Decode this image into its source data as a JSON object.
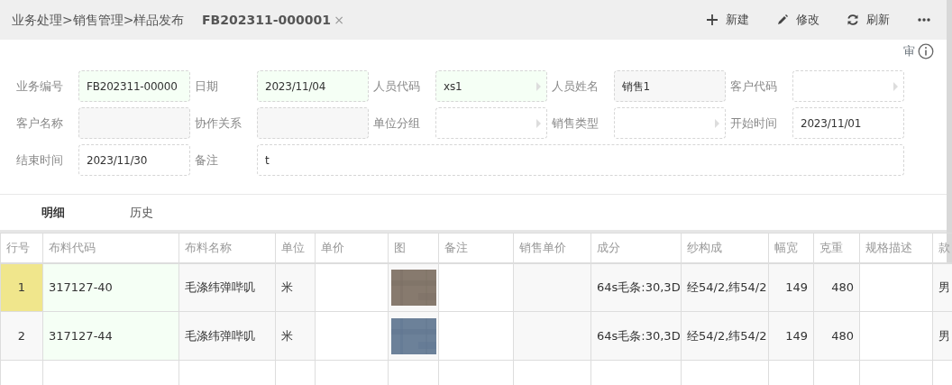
{
  "header": {
    "breadcrumb": "业务处理>销售管理>样品发布",
    "tab": {
      "label": "FB202311-000001",
      "close": "×"
    },
    "actions": [
      {
        "kind": "add",
        "label": "新建"
      },
      {
        "kind": "edit",
        "label": "修改"
      },
      {
        "kind": "refresh",
        "label": "刷新"
      },
      {
        "kind": "more"
      }
    ]
  },
  "audit": {
    "label": "审"
  },
  "form": [
    {
      "label": "业务编号",
      "value": "FB202311-00000",
      "kind": "required",
      "lookup": false
    },
    {
      "label": "日期",
      "value": "2023/11/04",
      "kind": "required",
      "lookup": false
    },
    {
      "label": "人员代码",
      "value": "xs1",
      "kind": "required",
      "lookup": true
    },
    {
      "label": "人员姓名",
      "value": "销售1",
      "kind": "readonly",
      "lookup": false
    },
    {
      "label": "客户代码",
      "kind": "normal",
      "lookup": true
    },
    {
      "label": "客户名称",
      "kind": "readonly",
      "lookup": false
    },
    {
      "label": "协作关系",
      "kind": "readonly",
      "lookup": false
    },
    {
      "label": "单位分组",
      "kind": "normal",
      "lookup": true
    },
    {
      "label": "销售类型",
      "kind": "normal",
      "lookup": true
    },
    {
      "label": "开始时间",
      "value": "2023/11/01",
      "kind": "normal",
      "lookup": false
    },
    {
      "label": "结束时间",
      "value": "2023/11/30",
      "kind": "normal",
      "lookup": false
    },
    {
      "label": "备注",
      "value": "t",
      "kind": "normal",
      "lookup": false,
      "wide": true
    }
  ],
  "tabs": [
    {
      "label": "明细",
      "selected": true
    },
    {
      "label": "历史",
      "selected": false
    }
  ],
  "table": {
    "columns": [
      {
        "label": "行号",
        "kind": "index"
      },
      {
        "label": "布料代码",
        "kind": "input"
      },
      {
        "label": "布料名称",
        "kind": "readonly"
      },
      {
        "label": "单位",
        "kind": "readonly"
      },
      {
        "label": "单价",
        "kind": "blank"
      },
      {
        "label": "图"
      },
      {
        "label": "备注",
        "kind": "blank"
      },
      {
        "label": "销售单价",
        "kind": "readonly"
      },
      {
        "label": "成分",
        "kind": "readonly"
      },
      {
        "label": "纱构成",
        "kind": "readonly"
      },
      {
        "label": "幅宽",
        "kind": "number"
      },
      {
        "label": "克重",
        "kind": "number"
      },
      {
        "label": "规格描述",
        "kind": "blank"
      },
      {
        "label": "款",
        "kind": "readonly"
      }
    ],
    "rows": [
      {
        "selected": true,
        "cells": [
          "1",
          "317127-40",
          "毛涤纬弹哔叽",
          "米",
          "",
          "",
          "",
          "",
          "64s毛条:30,3D",
          "经54/2,纬54/2",
          "149",
          "480",
          "",
          "男"
        ]
      },
      {
        "selected": false,
        "cells": [
          "2",
          "317127-44",
          "毛涤纬弹哔叽",
          "米",
          "",
          "",
          "",
          "",
          "64s毛条:30,3D",
          "经54/2,纬54/2",
          "149",
          "480",
          "",
          "男"
        ]
      }
    ]
  }
}
